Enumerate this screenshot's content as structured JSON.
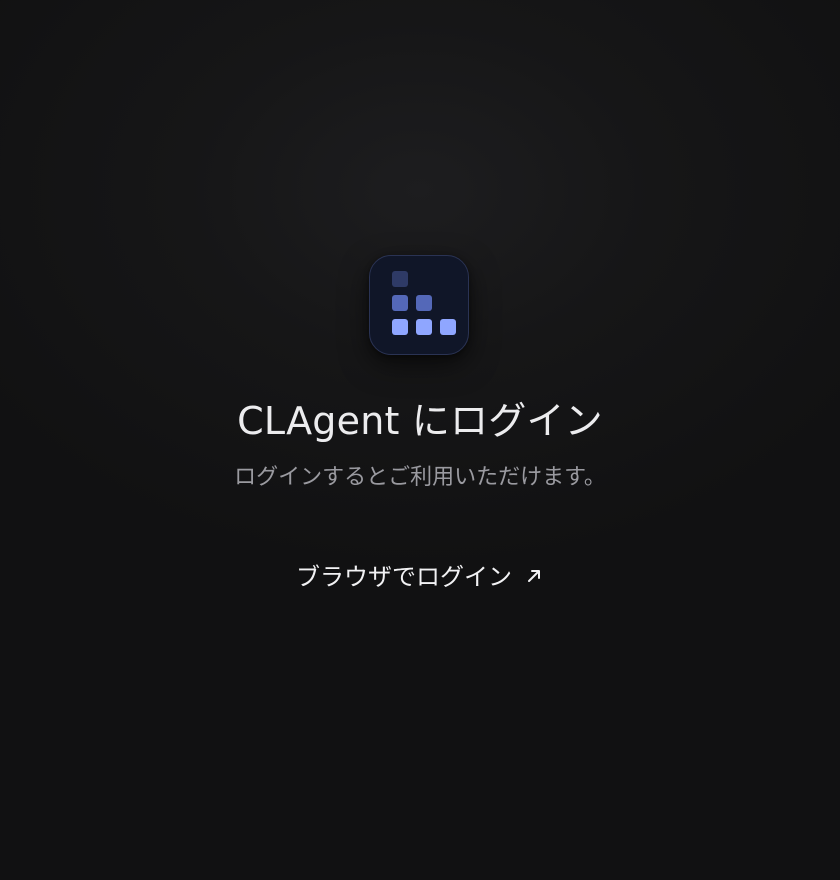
{
  "app": {
    "icon_name": "bar-grid-logo-icon",
    "icon_colors": {
      "background": "#101628",
      "border": "#2a3354",
      "top_block": "#2e3a66",
      "middle_blocks": "#5468b8",
      "bottom_blocks": "#8fa6ff"
    }
  },
  "login": {
    "title": "CLAgent にログイン",
    "subtitle": "ログインするとご利用いただけます。",
    "button_label": "ブラウザでログイン",
    "button_icon": "external-arrow-icon"
  }
}
